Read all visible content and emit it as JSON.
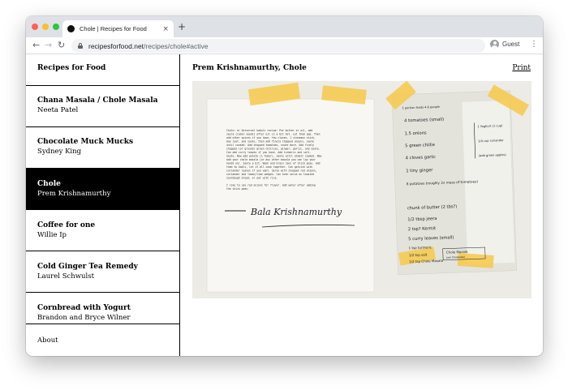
{
  "browser": {
    "tab_title": "Chole | Recipes for Food",
    "tab_close": "×",
    "new_tab": "+",
    "url_host": "recipesforfood.net",
    "url_path": "/recipes/chole#active",
    "profile_label": "Guest",
    "back": "←",
    "forward": "→",
    "reload": "↻",
    "menu": "⋮",
    "colors": {
      "close": "#ff5f57",
      "minimize": "#febc2e",
      "maximize": "#28c840",
      "tabstrip": "#dee1e6"
    }
  },
  "sidebar": {
    "site_title": "Recipes for Food",
    "items": [
      {
        "title": "Chana Masala / Chole Masala",
        "author": "Neeta Patel",
        "active": false
      },
      {
        "title": "Chocolate Muck Mucks",
        "author": "Sydney King",
        "active": false
      },
      {
        "title": "Chole",
        "author": "Prem Krishnamurthy",
        "active": true
      },
      {
        "title": "Coffee for one",
        "author": "Willie Ip",
        "active": false
      },
      {
        "title": "Cold Ginger Tea Remedy",
        "author": "Laurel Schwulst",
        "active": false
      },
      {
        "title": "Cornbread with Yogurt",
        "author": "Brandon and Bryce Wilner",
        "active": false
      }
    ],
    "about": "About"
  },
  "main": {
    "title": "Prem Krishnamurthy, Chole",
    "print": "Print",
    "photo": {
      "typed_note": [
        "Chole: or Universal kabuli recipe: Put butter or oil, add",
        "jeera (cumin seeds) after oil is a bit hot. Let them pop. Then",
        "add other spices if you have, few cloves, 1 cinnamon stick,",
        "bay leaf, and saute, then add finely chopped onions, saute",
        "until cooked. Add chopped tomatoes, saute more. Add finely",
        "chopped (or ground) green chillies, ginger, garlic, and saute.",
        "Can add curry leaves if you have. Add turmeric and salt.",
        "Saute. Now add potato (1 tuber), saute until almost cooked. Now",
        "add your chole masala (or any other masala you can lay your",
        "hands on). Saute a bit. Wash and drain cans of chick peas. Add",
        "them to kabli, let it all cook together. Can garnish with",
        "coriander leaves if you want. Serve with chopped red onions,",
        "coriander and lemon/lime wedges. Can even serve on toasted",
        "sourdough bread, or eat with rice.",
        "",
        "I like to use red onions for flavor. Add water after adding",
        "the chick peas."
      ],
      "signature": "Bala Krishnamurthy",
      "handwritten_list": [
        "1 portion feeds 4-6 people",
        "4 tomatoes (small)",
        "1.5 onions",
        "5 green chillie",
        "4 cloves garlic",
        "1 tiny ginger",
        "8 potatoes (roughly 2x mass of tomatoes)",
        "chunk of butter (2 tbs?)",
        "1/2 tbsp jeera",
        "2 tsp? Kermit",
        "5 curry leaves (small)",
        "1 tsp turmeric",
        "1/2 tsp salt",
        "1/2 tsp Chole Masala"
      ],
      "margin_notes": [
        "1 Yoghurt (1 cup)",
        "1/4 cup coriander",
        "(add green apples)"
      ],
      "masala_label": "Chole Masala",
      "masala_sub": "(am Chatpatta)"
    }
  }
}
